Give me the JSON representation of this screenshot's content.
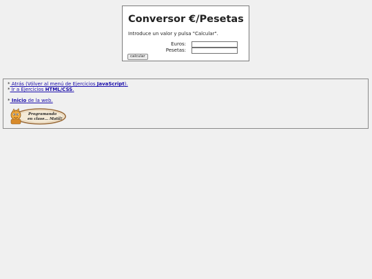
{
  "converter": {
    "title": "Conversor €/Pesetas",
    "intro": "Introduce un valor y pulsa \"Calcular\".",
    "euros_label": "Euros:",
    "pesetas_label": "Pesetas:",
    "euros_value": "",
    "pesetas_value": "",
    "button_label": "calcular"
  },
  "nav": {
    "bullet": "*",
    "back": {
      "prefix": " Atrás (Vólver al menú de Ejercicios ",
      "bold": "JavaScript",
      "suffix": ")."
    },
    "css": {
      "prefix": " Ir a Ejercicios ",
      "bold": "HTML/CSS",
      "suffix": "."
    },
    "home": {
      "bold": " Inicio",
      "suffix": " de la web."
    }
  },
  "logo": {
    "line1": "Programando",
    "line2": "en clase... Matil!"
  }
}
